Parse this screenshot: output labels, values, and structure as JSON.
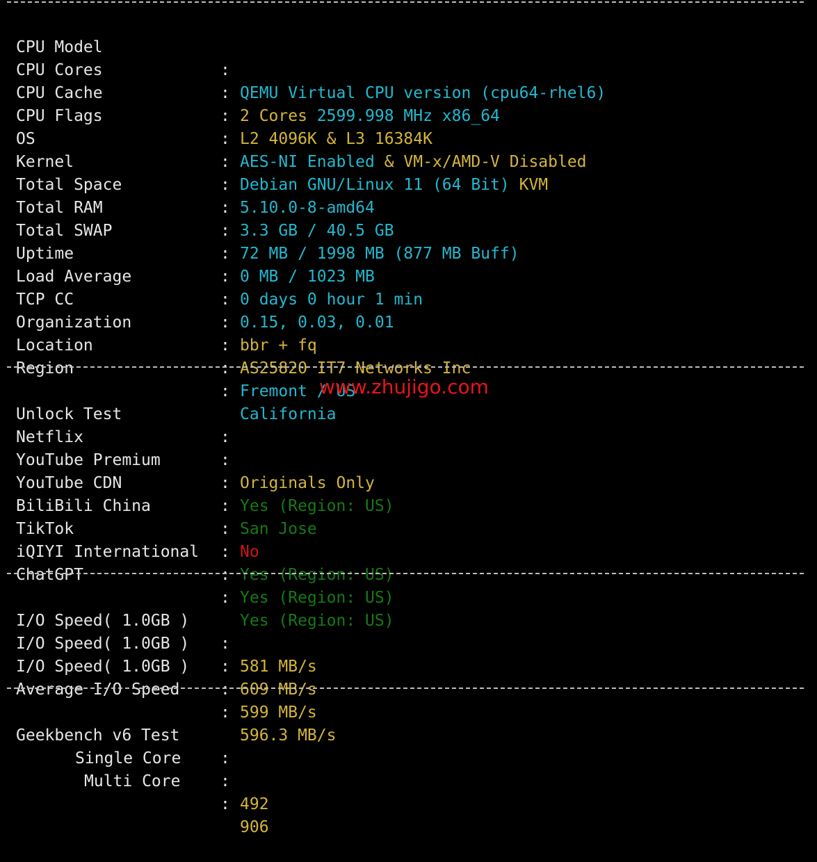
{
  "colors": {
    "cyan": "#22b8cf",
    "yellow": "#d4b53b",
    "green": "#167a16",
    "red": "#cc1515",
    "label": "#e6e6e6",
    "background": "#000000"
  },
  "separator_char": "-",
  "colon": ":",
  "watermark": "www.zhujigo.com",
  "system": {
    "cpu_model": {
      "label": "CPU Model",
      "value": "QEMU Virtual CPU version (cpu64-rhel6)"
    },
    "cpu_cores": {
      "label": "CPU Cores",
      "value_a": "2 Cores",
      "value_b": "2599.998 MHz x86_64"
    },
    "cpu_cache": {
      "label": "CPU Cache",
      "value": "L2 4096K & L3 16384K"
    },
    "cpu_flags": {
      "label": "CPU Flags",
      "value_a": "AES-NI Enabled",
      "value_b": "& VM-x/AMD-V Disabled"
    },
    "os": {
      "label": "OS",
      "value_a": "Debian GNU/Linux 11 (64 Bit)",
      "value_b": "KVM"
    },
    "kernel": {
      "label": "Kernel",
      "value": "5.10.0-8-amd64"
    },
    "total_space": {
      "label": "Total Space",
      "value": "3.3 GB / 40.5 GB"
    },
    "total_ram": {
      "label": "Total RAM",
      "value": "72 MB / 1998 MB (877 MB Buff)"
    },
    "total_swap": {
      "label": "Total SWAP",
      "value": "0 MB / 1023 MB"
    },
    "uptime": {
      "label": "Uptime",
      "value": "0 days 0 hour 1 min"
    },
    "load_average": {
      "label": "Load Average",
      "value": "0.15, 0.03, 0.01"
    },
    "tcp_cc": {
      "label": "TCP CC",
      "value": "bbr + fq"
    },
    "organization": {
      "label": "Organization",
      "value": "AS25820 IT7 Networks Inc"
    },
    "location": {
      "label": "Location",
      "value": "Fremont / US"
    },
    "region": {
      "label": "Region",
      "value": "California"
    }
  },
  "unlock": {
    "header": {
      "label": "Unlock Test"
    },
    "netflix": {
      "label": "Netflix",
      "value": "Originals Only"
    },
    "youtube_premium": {
      "label": "YouTube Premium",
      "value": "Yes (Region: US)"
    },
    "youtube_cdn": {
      "label": "YouTube CDN",
      "value": "San Jose"
    },
    "bilibili": {
      "label": "BiliBili China",
      "value": "No"
    },
    "tiktok": {
      "label": "TikTok",
      "value": "Yes (Region: US)"
    },
    "iqiyi": {
      "label": "iQIYI International",
      "value": "Yes (Region: US)"
    },
    "chatgpt": {
      "label": "ChatGPT",
      "value": "Yes (Region: US)"
    }
  },
  "io": {
    "run1": {
      "label": "I/O Speed( 1.0GB )",
      "value": "581 MB/s"
    },
    "run2": {
      "label": "I/O Speed( 1.0GB )",
      "value": "609 MB/s"
    },
    "run3": {
      "label": "I/O Speed( 1.0GB )",
      "value": "599 MB/s"
    },
    "average": {
      "label": "Average I/O Speed",
      "value": "596.3 MB/s"
    }
  },
  "geekbench": {
    "header": {
      "label": "Geekbench v6 Test"
    },
    "single": {
      "label": "Single Core",
      "value": "492"
    },
    "multi": {
      "label": "Multi Core",
      "value": "906"
    }
  }
}
